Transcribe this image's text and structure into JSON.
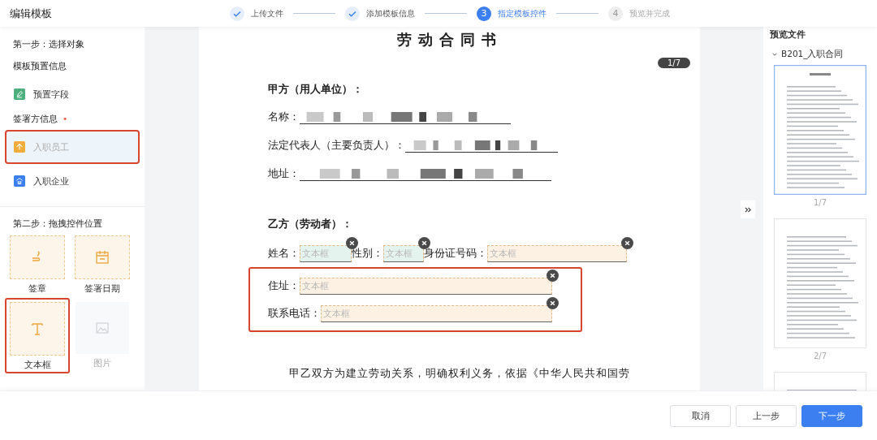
{
  "header": {
    "title": "编辑模板",
    "steps": [
      {
        "label": "上传文件",
        "completed": true,
        "selected": false
      },
      {
        "label": "添加模板信息",
        "completed": true,
        "selected": false
      },
      {
        "label": "指定模板控件",
        "completed": false,
        "selected": true,
        "number": "3"
      },
      {
        "label": "预览并完成",
        "completed": false,
        "selected": false,
        "number": "4"
      }
    ]
  },
  "sidebar": {
    "step1_title": "第一步：选择对象",
    "preset_title": "模板预置信息",
    "preset_items": [
      {
        "label": "预置字段",
        "color": "#4caf7d",
        "selected": false
      }
    ],
    "signer_title": "签署方信息",
    "signer_required_mark": "•",
    "signer_items": [
      {
        "label": "入职员工",
        "color": "#f0ad3c",
        "selected": true
      },
      {
        "label": "入职企业",
        "color": "#3b7ff0",
        "selected": false
      }
    ],
    "step2_title": "第二步：拖拽控件位置",
    "controls": [
      {
        "kind": "seal",
        "label": "签章",
        "selected": false,
        "disabled": false
      },
      {
        "kind": "date",
        "label": "签署日期",
        "selected": false,
        "disabled": false
      },
      {
        "kind": "text",
        "label": "文本框",
        "selected": true,
        "disabled": false
      },
      {
        "kind": "image",
        "label": "图片",
        "selected": false,
        "disabled": true
      }
    ]
  },
  "document": {
    "title": "劳动合同书",
    "page_badge": "1/7",
    "party_a": {
      "heading": "甲方（用人单位）：",
      "lines": [
        {
          "label": "名称：",
          "redacted": true
        },
        {
          "label": "法定代表人（主要负责人）：",
          "redacted": true
        },
        {
          "label": "地址：",
          "redacted": true
        }
      ]
    },
    "party_b": {
      "heading": "乙方（劳动者）：",
      "rows": [
        {
          "highlighted": false,
          "fields": [
            {
              "label": "姓名：",
              "placeholder": "文本框",
              "color": "#e4f3ee"
            },
            {
              "label": "性别：",
              "placeholder": "文本框",
              "color": "#e4f3ee"
            },
            {
              "label": "身份证号码：",
              "placeholder": "文本框",
              "color": "#fdf1e4"
            }
          ]
        },
        {
          "highlighted": true,
          "fields": [
            {
              "label": "住址：",
              "placeholder": "文本框",
              "color": "#fdf1e4"
            }
          ]
        },
        {
          "highlighted": true,
          "fields": [
            {
              "label": "联系电话：",
              "placeholder": "文本框",
              "color": "#fdf1e4"
            }
          ]
        }
      ]
    },
    "paragraph": "甲乙双方为建立劳动关系，明确权利义务，依据《中华人民共和国劳"
  },
  "preview": {
    "title": "预览文件",
    "file": {
      "name": "B201_入职合同",
      "expanded": true
    },
    "pages": [
      {
        "label": "1/7",
        "selected": true
      },
      {
        "label": "2/7",
        "selected": false
      },
      {
        "selected": false
      }
    ]
  },
  "footer": {
    "buttons": [
      {
        "label": "取消",
        "kind": "default"
      },
      {
        "label": "上一步",
        "kind": "default"
      },
      {
        "label": "下一步",
        "kind": "primary"
      }
    ]
  }
}
